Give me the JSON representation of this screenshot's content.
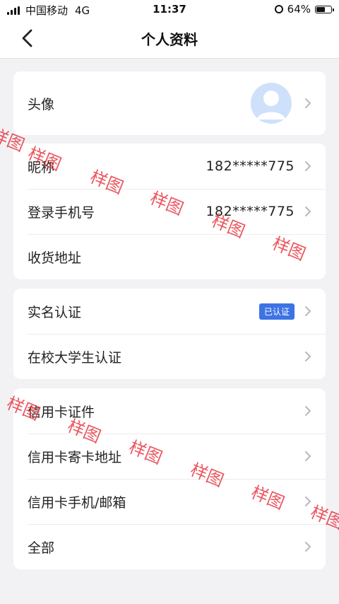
{
  "status_bar": {
    "carrier": "中国移动",
    "network": "4G",
    "time": "11:37",
    "battery": "64%",
    "battery_level": 0.64
  },
  "nav": {
    "title": "个人资料"
  },
  "sections": {
    "avatar": {
      "label": "头像"
    },
    "account": [
      {
        "label": "昵称",
        "value": "182*****775"
      },
      {
        "label": "登录手机号",
        "value": "182*****775"
      },
      {
        "label": "收货地址",
        "value": ""
      }
    ],
    "verification": [
      {
        "label": "实名认证",
        "badge": "已认证"
      },
      {
        "label": "在校大学生认证"
      }
    ],
    "credit": [
      {
        "label": "信用卡证件"
      },
      {
        "label": "信用卡寄卡地址"
      },
      {
        "label": "信用卡手机/邮箱"
      },
      {
        "label": "全部"
      }
    ]
  },
  "watermark": "样图",
  "colors": {
    "accent": "#3d73e4",
    "avatar_bg": "#cfe0fb",
    "watermark": "#e62832"
  }
}
